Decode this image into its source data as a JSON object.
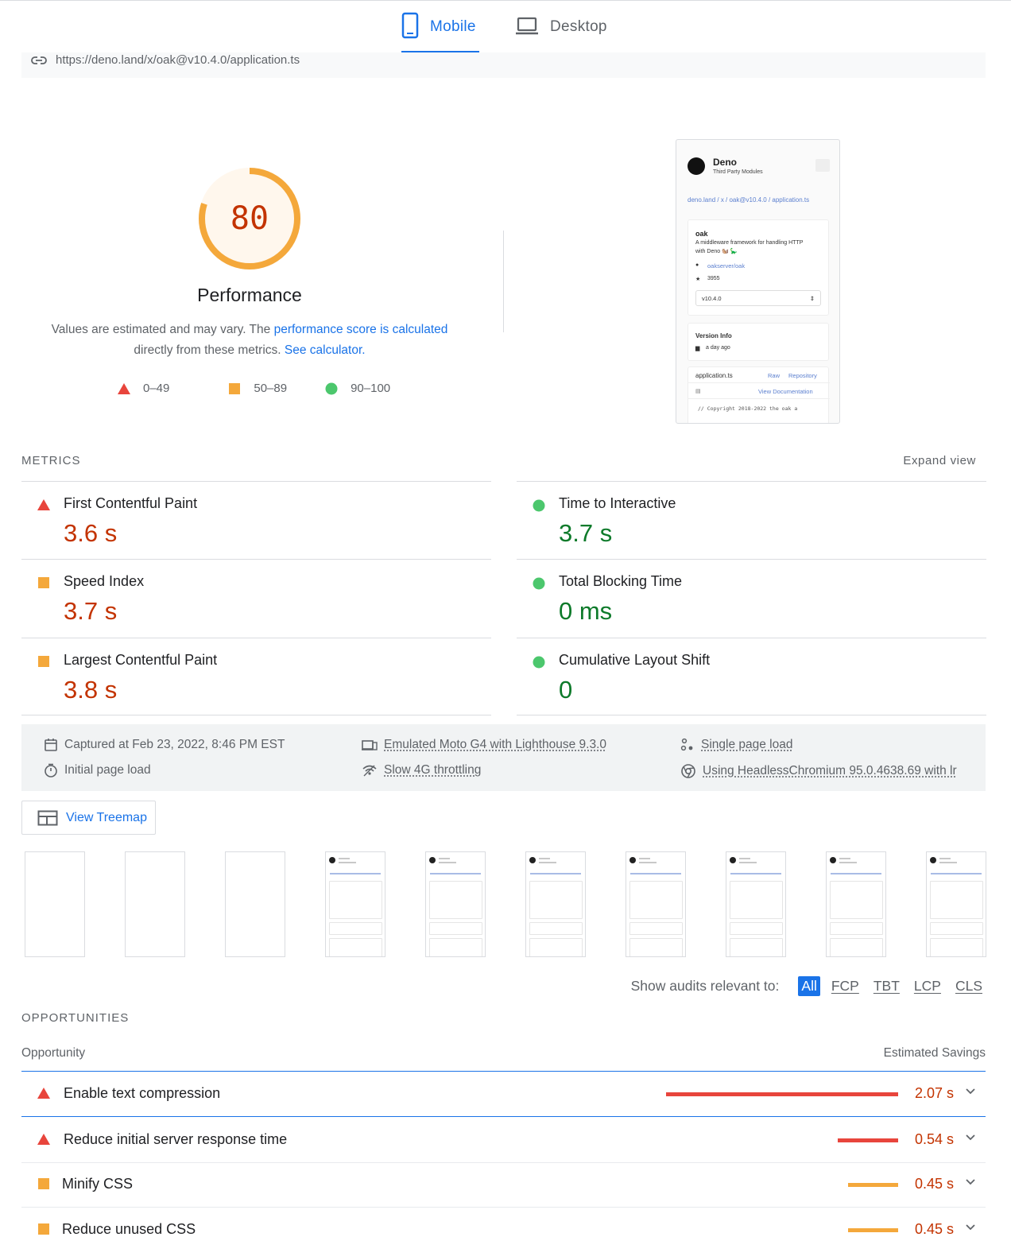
{
  "tabs": {
    "mobile": "Mobile",
    "desktop": "Desktop"
  },
  "url": "https://deno.land/x/oak@v10.4.0/application.ts",
  "performance": {
    "score": "80",
    "score_value": 80,
    "title": "Performance",
    "desc_before": "Values are estimated and may vary. The ",
    "desc_link": "performance score is calculated",
    "desc_middle": "directly from these metrics. ",
    "desc_link2": "See calculator.",
    "gauge_color": "#f4a83b"
  },
  "legend": [
    {
      "icon": "triangle",
      "label": "0–49"
    },
    {
      "icon": "square",
      "label": "50–89"
    },
    {
      "icon": "circle",
      "label": "90–100"
    }
  ],
  "thumbnail": {
    "title": "Deno",
    "subtitle": "Third Party Modules",
    "breadcrumb": "deno.land / x / oak@v10.4.0 / application.ts",
    "module_name": "oak",
    "module_desc_1": "A middleware framework for handling HTTP",
    "module_desc_2": "with Deno 🐿️ 🦕",
    "repo": "oakserver/oak",
    "stars": "3955",
    "version": "v10.4.0",
    "version_info": "Version Info",
    "date": "a day ago",
    "file": "application.ts",
    "raw": "Raw",
    "repository": "Repository",
    "view_docs": "View Documentation",
    "code_line": "// Copyright 2018-2022 the oak a"
  },
  "metrics": {
    "title": "METRICS",
    "expand": "Expand view",
    "items": [
      {
        "name": "First Contentful Paint",
        "value": "3.6 s",
        "status": "red"
      },
      {
        "name": "Time to Interactive",
        "value": "3.7 s",
        "status": "green"
      },
      {
        "name": "Speed Index",
        "value": "3.7 s",
        "status": "orange"
      },
      {
        "name": "Total Blocking Time",
        "value": "0 ms",
        "status": "green"
      },
      {
        "name": "Largest Contentful Paint",
        "value": "3.8 s",
        "status": "orange"
      },
      {
        "name": "Cumulative Layout Shift",
        "value": "0",
        "status": "green"
      }
    ]
  },
  "environment": {
    "captured": "Captured at Feb 23, 2022, 8:46 PM EST",
    "initial_load": "Initial page load",
    "device": "Emulated Moto G4 with Lighthouse 9.3.0",
    "throttling": "Slow 4G throttling",
    "single_load": "Single page load",
    "browser": "Using HeadlessChromium 95.0.4638.69 with lr"
  },
  "treemap": "View Treemap",
  "filter": {
    "label": "Show audits relevant to:",
    "chips": [
      "All",
      "FCP",
      "TBT",
      "LCP",
      "CLS"
    ]
  },
  "opportunities": {
    "title": "OPPORTUNITIES",
    "col_left": "Opportunity",
    "col_right": "Estimated Savings",
    "items": [
      {
        "name": "Enable text compression",
        "savings": "2.07 s",
        "savings_s": 2.07,
        "status": "red"
      },
      {
        "name": "Reduce initial server response time",
        "savings": "0.54 s",
        "savings_s": 0.54,
        "status": "red"
      },
      {
        "name": "Minify CSS",
        "savings": "0.45 s",
        "savings_s": 0.45,
        "status": "orange"
      },
      {
        "name": "Reduce unused CSS",
        "savings": "0.45 s",
        "savings_s": 0.45,
        "status": "orange"
      }
    ]
  },
  "colors": {
    "red": "#e8453c",
    "orange": "#f4a83b",
    "green": "#4cc76d",
    "accent": "#1a73e8"
  }
}
